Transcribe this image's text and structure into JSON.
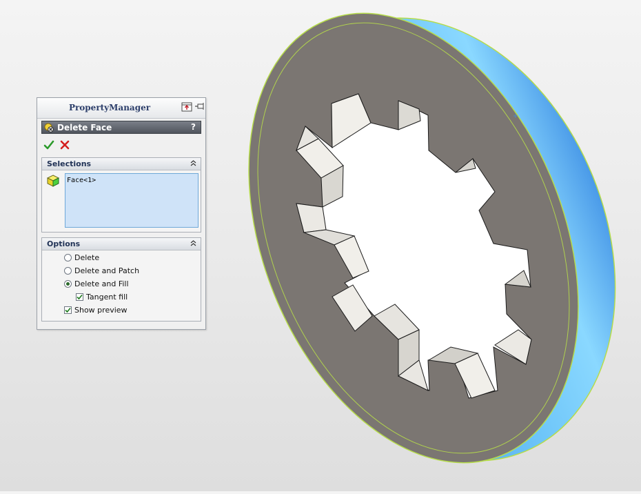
{
  "property_manager": {
    "title": "PropertyManager",
    "feature": {
      "title": "Delete Face",
      "help_label": "?",
      "icon": "delete-face-icon"
    },
    "actions": {
      "ok_icon": "checkmark-icon",
      "cancel_icon": "red-x-icon"
    },
    "selections": {
      "title": "Selections",
      "items": [
        "Face<1>"
      ]
    },
    "options": {
      "title": "Options",
      "radios": [
        {
          "label": "Delete",
          "selected": false
        },
        {
          "label": "Delete and Patch",
          "selected": false
        },
        {
          "label": "Delete and Fill",
          "selected": true
        }
      ],
      "tangent_fill": {
        "label": "Tangent fill",
        "checked": true
      },
      "show_preview": {
        "label": "Show preview",
        "checked": true
      }
    }
  },
  "colors": {
    "part_face": "#7b7672",
    "part_rim": "#5aaef0",
    "edge_highlight": "#b6dc4a",
    "tooth_face": "#f4f2ee"
  }
}
